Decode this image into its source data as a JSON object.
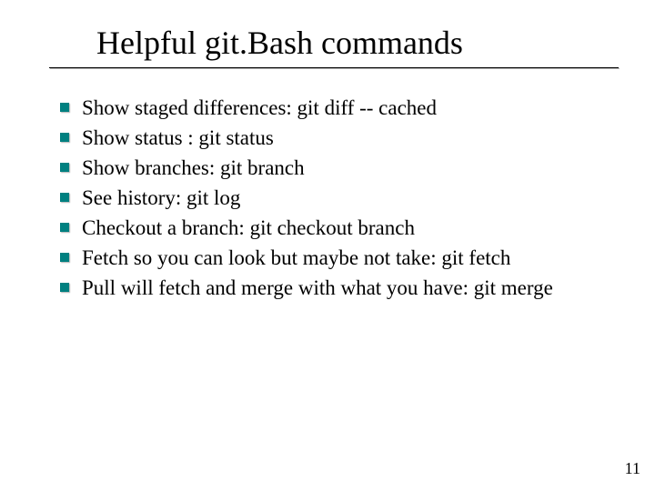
{
  "slide": {
    "title": "Helpful git.Bash commands",
    "bullets": [
      "Show staged differences: git diff -- cached",
      "Show status : git status",
      "Show branches: git branch",
      "See history: git log",
      "Checkout a branch: git checkout branch",
      "Fetch  so you can look but maybe not take: git fetch",
      "Pull will fetch and merge with what you have: git merge"
    ],
    "page_number": "11"
  }
}
